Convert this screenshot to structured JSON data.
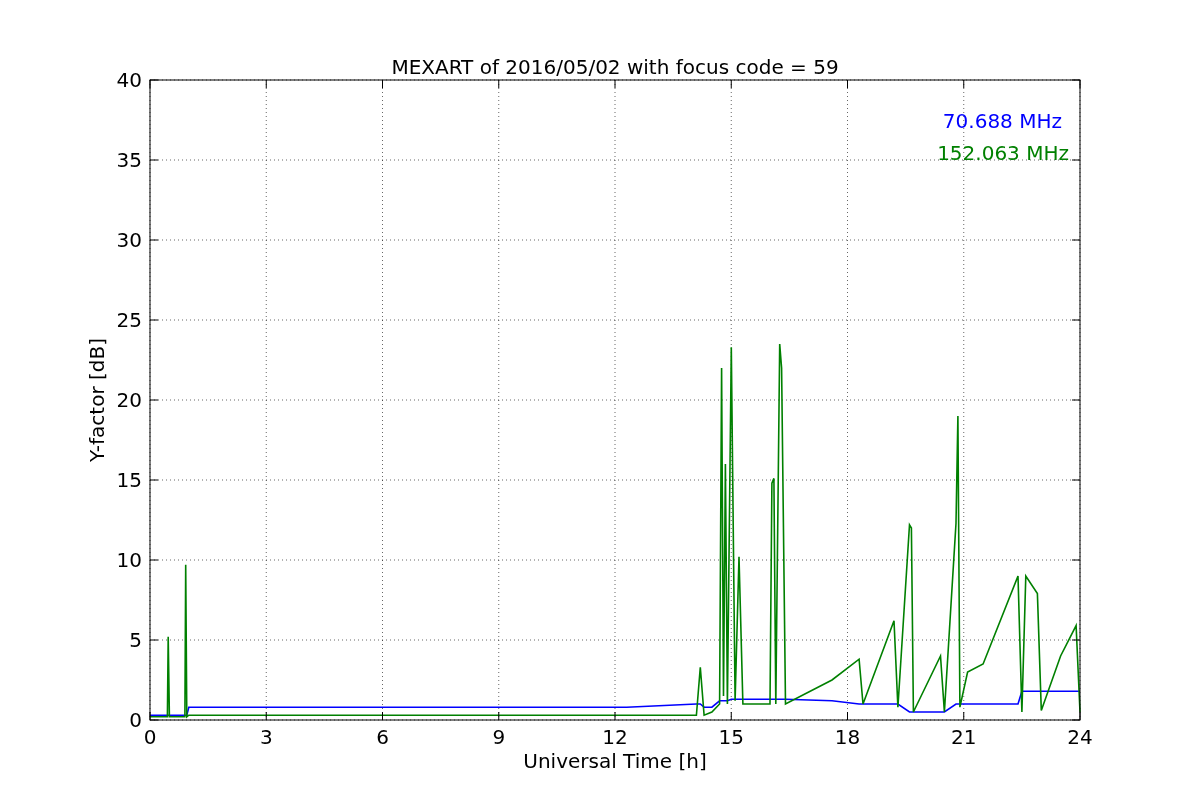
{
  "figure": {
    "chart_data": {
      "type": "line",
      "title": "MEXART of 2016/05/02 with focus code = 59",
      "xlabel": "Universal Time [h]",
      "ylabel": "Y-factor [dB]",
      "x": [
        0,
        0.45,
        0.47,
        0.5,
        0.9,
        0.92,
        0.95,
        1,
        12.3,
        14.1,
        14.2,
        14.3,
        14.5,
        14.7,
        14.75,
        14.8,
        14.85,
        14.9,
        15.0,
        15.1,
        15.2,
        15.3,
        16.0,
        16.05,
        16.1,
        16.15,
        16.25,
        16.3,
        16.4,
        17.6,
        18.3,
        18.4,
        19.2,
        19.3,
        19.6,
        19.65,
        19.7,
        20.4,
        20.5,
        20.8,
        20.85,
        20.9,
        21.1,
        21.5,
        22.4,
        22.5,
        22.6,
        22.9,
        23.0,
        23.5,
        23.9,
        24
      ],
      "series": [
        {
          "name": "70.688 MHz",
          "color": "#0000ff",
          "values": [
            0.3,
            0.3,
            0.3,
            0.3,
            0.3,
            0.3,
            0.3,
            0.8,
            0.8,
            1.0,
            1.0,
            0.8,
            0.8,
            1.2,
            1.2,
            1.2,
            1.2,
            1.2,
            1.3,
            1.3,
            1.3,
            1.3,
            1.3,
            1.3,
            1.3,
            1.3,
            1.3,
            1.3,
            1.3,
            1.2,
            1.0,
            1.0,
            1.0,
            1.0,
            0.5,
            0.5,
            0.5,
            0.5,
            0.5,
            1.0,
            1.0,
            1.0,
            1.0,
            1.0,
            1.0,
            1.8,
            1.8,
            1.8,
            1.8,
            1.8,
            1.8,
            1.8
          ]
        },
        {
          "name": "152.063 MHz",
          "color": "#008000",
          "values": [
            0.2,
            0.2,
            5.2,
            0.2,
            0.2,
            9.7,
            0.2,
            0.3,
            0.3,
            0.3,
            3.3,
            0.3,
            0.5,
            1.0,
            22.0,
            1.5,
            16.0,
            1.0,
            23.3,
            1.2,
            10.2,
            1.0,
            1.0,
            14.8,
            15.1,
            1.0,
            23.5,
            22.0,
            1.0,
            2.5,
            3.8,
            1.0,
            6.2,
            0.8,
            12.2,
            12.0,
            0.5,
            4.0,
            0.5,
            12.3,
            19.0,
            0.8,
            3.0,
            3.5,
            9.0,
            0.5,
            9.0,
            7.9,
            0.6,
            4.0,
            5.9,
            0.5
          ]
        }
      ],
      "grid": true,
      "xlim": [
        0,
        24
      ],
      "ylim": [
        0,
        40
      ],
      "xticks": [
        0,
        3,
        6,
        9,
        12,
        15,
        18,
        21,
        24
      ],
      "yticks": [
        0,
        5,
        10,
        15,
        20,
        25,
        30,
        35,
        40
      ]
    }
  }
}
